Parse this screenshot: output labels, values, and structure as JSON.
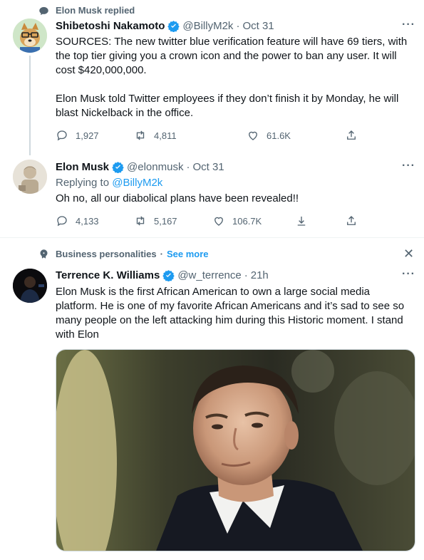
{
  "reply_context": {
    "label": "Elon Musk replied"
  },
  "tweet1": {
    "name": "Shibetoshi Nakamoto",
    "handle": "@BillyM2k",
    "sep": "·",
    "time": "Oct 31",
    "para1": "SOURCES: The new twitter blue verification feature will have 69 tiers, with the top tier giving you a crown icon and the power to ban any user. It will cost $420,000,000.",
    "para2": "Elon Musk told Twitter employees if they don’t finish it by Monday, he will blast Nickelback in the office.",
    "replies": "1,927",
    "retweets": "4,811",
    "likes": "61.6K",
    "more": "···"
  },
  "tweet2": {
    "name": "Elon Musk",
    "handle": "@elonmusk",
    "sep": "·",
    "time": "Oct 31",
    "replying_prefix": "Replying to ",
    "replying_handle": "@BillyM2k",
    "text": "Oh no, all our diabolical plans have been revealed!!",
    "replies": "4,133",
    "retweets": "5,167",
    "likes": "106.7K",
    "more": "···"
  },
  "topic": {
    "label": "Business personalities",
    "sep": "·",
    "see_more": "See more",
    "close": "✕"
  },
  "tweet3": {
    "name": "Terrence K. Williams",
    "handle": "@w_terrence",
    "sep": "·",
    "time": "21h",
    "text": "Elon Musk is the first African American to own a large social media platform. He is one of my favorite African Americans and it’s sad to see so many people on the left attacking him during this Historic moment. I stand with Elon",
    "more": "···"
  },
  "colors": {
    "accent": "#1d9bf0",
    "muted": "#536471",
    "text": "#0f1419",
    "line": "#cfd9de"
  }
}
